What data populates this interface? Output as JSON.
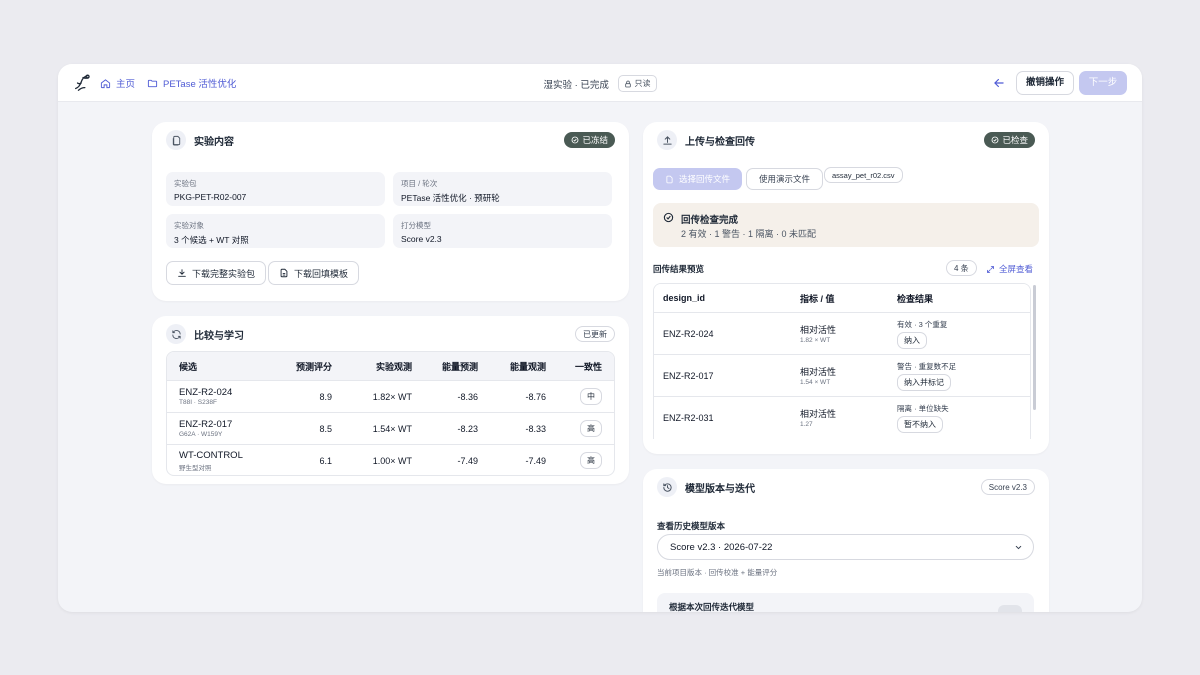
{
  "topbar": {
    "home_label": "主页",
    "project_label": "PETase 活性优化",
    "status_title": "湿实验 · 已完成",
    "readonly_label": "只读",
    "undo_label": "撤销操作",
    "next_label": "下一步"
  },
  "experiment": {
    "title": "实验内容",
    "badge": "已冻结",
    "fields": [
      {
        "label": "实验包",
        "value": "PKG-PET-R02-007"
      },
      {
        "label": "项目 / 轮次",
        "value": "PETase 活性优化 · 预研轮"
      },
      {
        "label": "实验对象",
        "value": "3 个候选 + WT 对照"
      },
      {
        "label": "打分模型",
        "value": "Score v2.3"
      }
    ],
    "download_package": "下载完整实验包",
    "download_template": "下载回填模板"
  },
  "compare": {
    "title": "比较与学习",
    "badge": "已更新",
    "columns": [
      "候选",
      "预测评分",
      "实验观测",
      "能量预测",
      "能量观测",
      "一致性"
    ],
    "rows": [
      {
        "name": "ENZ-R2-024",
        "mut": "T88I · S238F",
        "pred": "8.9",
        "obs": "1.82× WT",
        "e_pred": "-8.36",
        "e_obs": "-8.76",
        "agree": "中"
      },
      {
        "name": "ENZ-R2-017",
        "mut": "G62A · W159Y",
        "pred": "8.5",
        "obs": "1.54× WT",
        "e_pred": "-8.23",
        "e_obs": "-8.33",
        "agree": "高"
      },
      {
        "name": "WT-CONTROL",
        "mut": "野生型对照",
        "pred": "6.1",
        "obs": "1.00× WT",
        "e_pred": "-7.49",
        "e_obs": "-7.49",
        "agree": "高"
      }
    ]
  },
  "upload": {
    "title": "上传与检查回传",
    "badge": "已检查",
    "choose_file": "选择回传文件",
    "use_demo": "使用演示文件",
    "file_name": "assay_pet_r02.csv",
    "check_title": "回传检查完成",
    "check_summary": "2 有效 · 1 警告 · 1 隔离 · 0 未匹配",
    "preview_label": "回传结果预览",
    "count": "4 条",
    "fullscreen": "全屏查看",
    "columns": [
      "design_id",
      "指标 / 值",
      "检查结果"
    ],
    "rows": [
      {
        "id": "ENZ-R2-024",
        "metric": "相对活性",
        "value": "1.82 × WT",
        "status": "有效 · 3 个重复",
        "action": "纳入"
      },
      {
        "id": "ENZ-R2-017",
        "metric": "相对活性",
        "value": "1.54 × WT",
        "status": "警告 · 重复数不足",
        "action": "纳入并标记"
      },
      {
        "id": "ENZ-R2-031",
        "metric": "相对活性",
        "value": "1.27",
        "status": "隔离 · 单位缺失",
        "action": "暂不纳入"
      }
    ]
  },
  "model": {
    "title": "模型版本与迭代",
    "badge": "Score v2.3",
    "history_label": "查看历史模型版本",
    "selected": "Score v2.3 · 2026-07-22",
    "hint": "当前项目版本 · 回传校准 + 能量评分",
    "iterate_label": "根据本次回传迭代模型"
  },
  "colors": {
    "accent": "#4f5bd5",
    "accent_disabled": "#c4c8f0",
    "badge_dark": "#4a5a54",
    "check_bg": "#f5f0ea"
  }
}
